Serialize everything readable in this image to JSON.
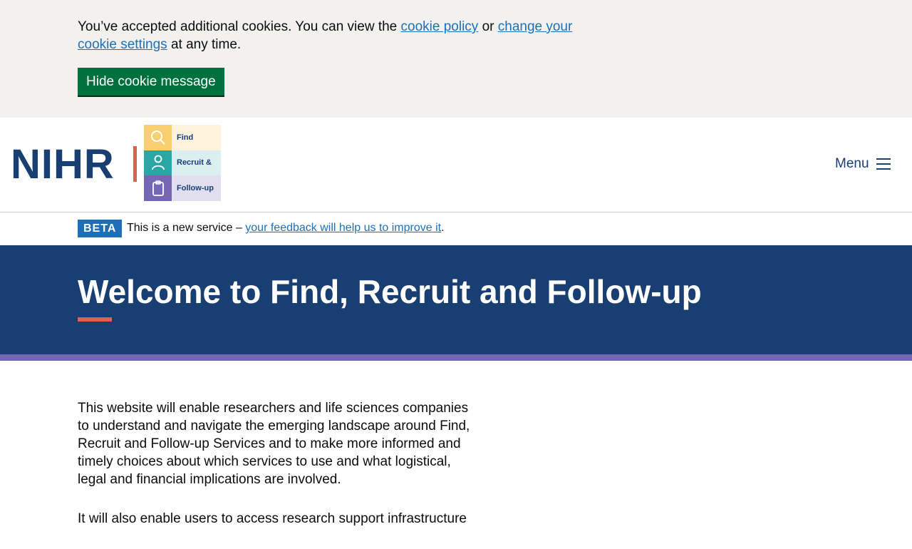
{
  "cookie_banner": {
    "text_before": "You’ve accepted additional cookies. You can view the ",
    "cookie_policy_link": "cookie policy",
    "text_middle": " or ",
    "change_settings_link": "change your cookie settings",
    "text_after": " at any time.",
    "hide_button": "Hide cookie message"
  },
  "header": {
    "logo_text": "NIHR",
    "frf_items": [
      {
        "label": "Find",
        "icon": "search-icon",
        "icon_bg": "#f9cf6f",
        "label_bg": "#fdf3dc"
      },
      {
        "label": "Recruit &",
        "icon": "person-icon",
        "icon_bg": "#2aa6a7",
        "label_bg": "#dbeef0"
      },
      {
        "label": "Follow-up",
        "icon": "clipboard-icon",
        "icon_bg": "#7567b3",
        "label_bg": "#e1def0"
      }
    ],
    "menu_label": "Menu"
  },
  "phase_banner": {
    "tag": "BETA",
    "text": "This is a new service – ",
    "link": "your feedback will help us to improve it",
    "suffix": "."
  },
  "hero": {
    "title": "Welcome to Find, Recruit and Follow-up"
  },
  "main": {
    "paragraph_1": "This website will enable researchers and life sciences companies to understand and navigate the emerging landscape around Find, Recruit and Follow-up Services and to make more informed and timely choices about which services to use and what logistical, legal and financial implications are involved.",
    "paragraph_2": "It will also enable users to access research support infrastructure"
  },
  "colors": {
    "brand_navy": "#193e72",
    "accent_coral": "#e05f4f",
    "accent_purple": "#7567b3",
    "link_blue": "#1d70b8",
    "button_green": "#00703c"
  }
}
